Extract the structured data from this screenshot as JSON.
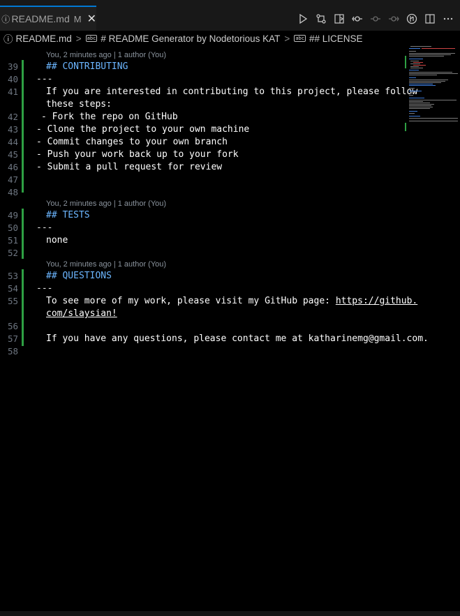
{
  "tab": {
    "info_icon": "info-icon",
    "filename": "README.md",
    "status": "M"
  },
  "breadcrumb": {
    "file": "README.md",
    "h1": "# README Generator by Nodetorious KAT",
    "h2": "## LICENSE"
  },
  "lens": "You, 2 minutes ago | 1 author (You)",
  "lines": {
    "l39": "## CONTRIBUTING",
    "l40": "---",
    "l41a": "If you are interested in contributing to this project, please follow",
    "l41b": "these steps:",
    "l42": "- Fork the repo on GitHub",
    "l43": "- Clone the project to your own machine",
    "l44": "- Commit changes to your own branch",
    "l45": "- Push your work back up to your fork",
    "l46": "- Submit a pull request for review",
    "l49": "## TESTS",
    "l50": "---",
    "l51": "none",
    "l53": "## QUESTIONS",
    "l54": "---",
    "l55a": "To see more of my work, please visit my GitHub page: ",
    "l55link1": "https://github.",
    "l55link2": "com/slaysian!",
    "l57": "If you have any questions, please contact me at katharinemg@gmail.com."
  },
  "line_numbers": {
    "n39": "39",
    "n40": "40",
    "n41": "41",
    "n42": "42",
    "n43": "43",
    "n44": "44",
    "n45": "45",
    "n46": "46",
    "n47": "47",
    "n48": "48",
    "n49": "49",
    "n50": "50",
    "n51": "51",
    "n52": "52",
    "n53": "53",
    "n54": "54",
    "n55": "55",
    "n56": "56",
    "n57": "57",
    "n58": "58"
  },
  "colors": {
    "heading": "#6cb6ff",
    "git_added": "#2ea043",
    "background": "#000000"
  }
}
